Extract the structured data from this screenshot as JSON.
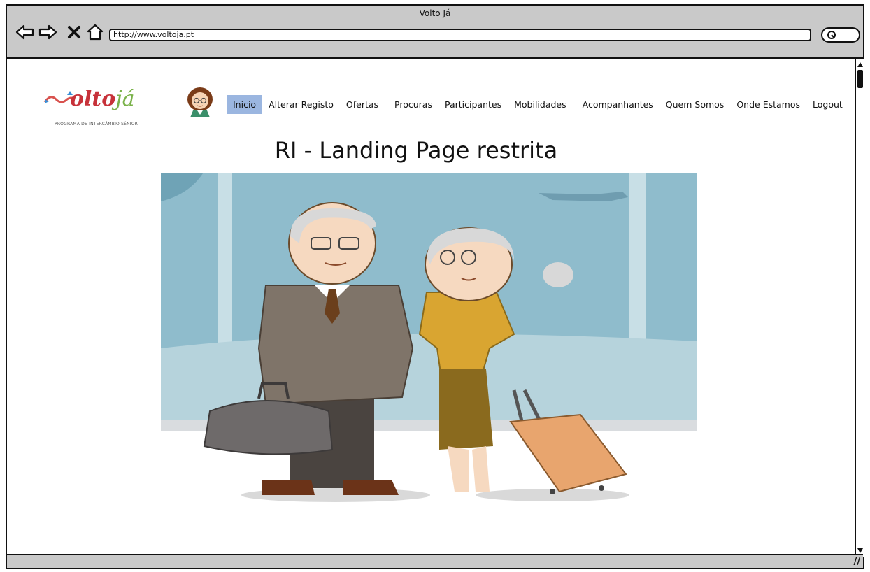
{
  "window": {
    "title": "Volto Já"
  },
  "browser": {
    "url": "http://www.voltoja.pt"
  },
  "logo": {
    "main": "olto",
    "accent": "já",
    "tagline": "PROGRAMA DE INTERCÂMBIO SÉNIOR"
  },
  "menu": {
    "items": [
      {
        "label": "Inicio",
        "active": true
      },
      {
        "label": "Alterar Registo"
      },
      {
        "label": "Ofertas"
      },
      {
        "label": "Procuras"
      },
      {
        "label": "Participantes"
      },
      {
        "label": "Mobilidades"
      },
      {
        "label": "Acompanhantes"
      },
      {
        "label": "Quem Somos"
      },
      {
        "label": "Onde Estamos"
      },
      {
        "label": "Logout"
      }
    ]
  },
  "page": {
    "title": "RI - Landing Page restrita"
  },
  "colors": {
    "active_menu": "#9bb6e0",
    "chrome": "#c9c9c9",
    "sky": "#8fbccc"
  },
  "icons": [
    "back-arrow-icon",
    "forward-arrow-icon",
    "close-icon",
    "home-icon",
    "search-icon",
    "avatar-icon"
  ]
}
